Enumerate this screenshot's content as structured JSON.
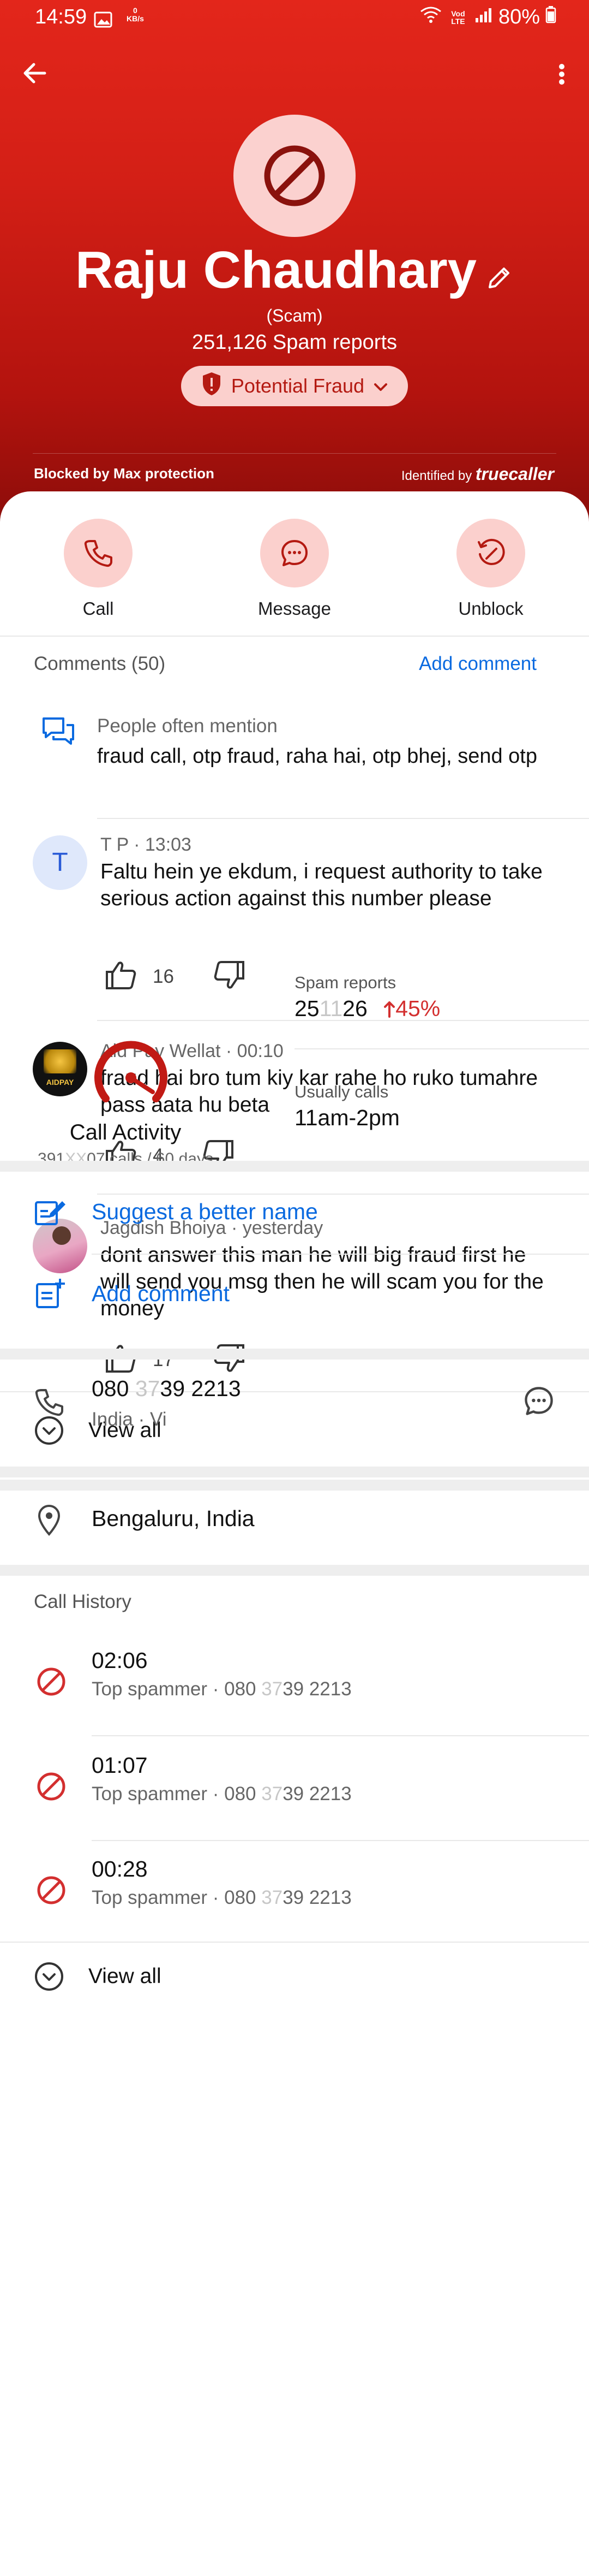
{
  "status_bar": {
    "time": "14:59",
    "net_speed_value": "0",
    "net_speed_unit": "KB/s",
    "carrier_tag": "Vod LTE",
    "battery": "80%"
  },
  "contact": {
    "name": "Raju Chaudhary",
    "tag": "(Scam)",
    "spam_reports_line": "251,126 Spam reports",
    "badge": "Potential Fraud",
    "blocked_by": "Blocked by Max protection",
    "identified_by": "Identified by",
    "identified_brand": "truecaller"
  },
  "actions": {
    "call": "Call",
    "message": "Message",
    "unblock": "Unblock"
  },
  "comments_section": {
    "header": "Comments (50)",
    "add_link": "Add comment",
    "mention_title": "People often mention",
    "mention_text": "fraud call, otp fraud, raha hai, otp bhej, send otp",
    "items": [
      {
        "avatar_letter": "T",
        "header": "T P · 13:03",
        "text": "Faltu hein ye ekdum, i request authority to take serious action against this number please",
        "likes": "16"
      },
      {
        "avatar_letter": "AIDPAY",
        "header": "Aid Pay Wellat · 00:10",
        "text": "fraud hai bro tum kiy kar rahe ho ruko tumahre pass aata hu  beta",
        "likes": "4"
      },
      {
        "avatar_letter": "",
        "header": "Jagdish Bhoiya · yesterday",
        "text": "dont answer this man he will big fraud first he will send you msg then he will scam you for the money",
        "likes": "17"
      }
    ],
    "view_all": "View all"
  },
  "stats": {
    "call_activity_title": "Call Activity",
    "call_activity_pre": "391",
    "call_activity_blur": "XX",
    "call_activity_post": "07 calls / 60 days",
    "spam_reports_label": "Spam reports",
    "spam_pre": "25",
    "spam_blur": "11",
    "spam_post": "26",
    "spam_change": "45%",
    "usually_calls_label": "Usually calls",
    "usually_calls_value": "11am-2pm"
  },
  "suggest": {
    "suggest_name": "Suggest a better name",
    "add_comment": "Add comment"
  },
  "number": {
    "pre": "080 ",
    "blur": "37",
    "post": "39 2213",
    "region": "India · Vi"
  },
  "location": "Bengaluru, India",
  "call_history": {
    "header": "Call History",
    "items": [
      {
        "time": "02:06",
        "label": "Top spammer · 080 ",
        "blur": "37",
        "post": "39 2213"
      },
      {
        "time": "01:07",
        "label": "Top spammer · 080 ",
        "blur": "37",
        "post": "39 2213"
      },
      {
        "time": "00:28",
        "label": "Top spammer · 080 ",
        "blur": "37",
        "post": "39 2213"
      }
    ],
    "view_all": "View all"
  },
  "colors": {
    "hero_red": "#d31f16",
    "accent_blue": "#0a6ae0",
    "pill_bg": "#fbd0cd",
    "danger": "#d32f2f"
  }
}
